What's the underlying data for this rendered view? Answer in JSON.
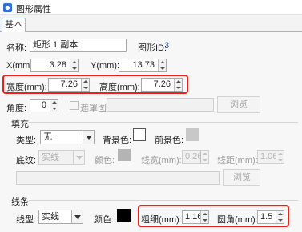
{
  "window": {
    "title": "图形属性",
    "icon": "app-icon"
  },
  "tabs": [
    {
      "label": "基本"
    }
  ],
  "basic": {
    "name_label": "名称:",
    "name_value": "矩形 1 副本",
    "id_label": "图形ID:",
    "id_value": "3",
    "x_label": "X(mm):",
    "x_value": "3.28",
    "y_label": "Y(mm):",
    "y_value": "13.73",
    "width_label": "宽度(mm):",
    "width_value": "7.26",
    "height_label": "高度(mm):",
    "height_value": "7.26",
    "angle_label": "角度:",
    "angle_value": "0",
    "mask_label": "遮罩图",
    "mask_path": "",
    "browse_label": "浏览"
  },
  "fill": {
    "section_label": "填充",
    "type_label": "类型:",
    "type_value": "无",
    "bg_color_label": "背景色:",
    "bg_color": "#ffffff",
    "fg_color_label": "前景色:",
    "fg_color": "#c8c8c8",
    "texture_label": "底纹:",
    "texture_value": "实线",
    "color_label": "颜色:",
    "color": "#b4b4b4",
    "line_width_label": "线宽(mm):",
    "line_width_value": "0.26",
    "line_spacing_label": "线距(mm):",
    "line_spacing_value": "1.06",
    "image_path": "",
    "browse_label": "浏览"
  },
  "line": {
    "section_label": "线条",
    "type_label": "线型:",
    "type_value": "实线",
    "color_label": "颜色:",
    "color": "#000000",
    "thickness_label": "粗细(mm):",
    "thickness_value": "1.16",
    "radius_label": "圆角(mm):",
    "radius_value": "1.5"
  },
  "highlight_color": "#e8221b"
}
